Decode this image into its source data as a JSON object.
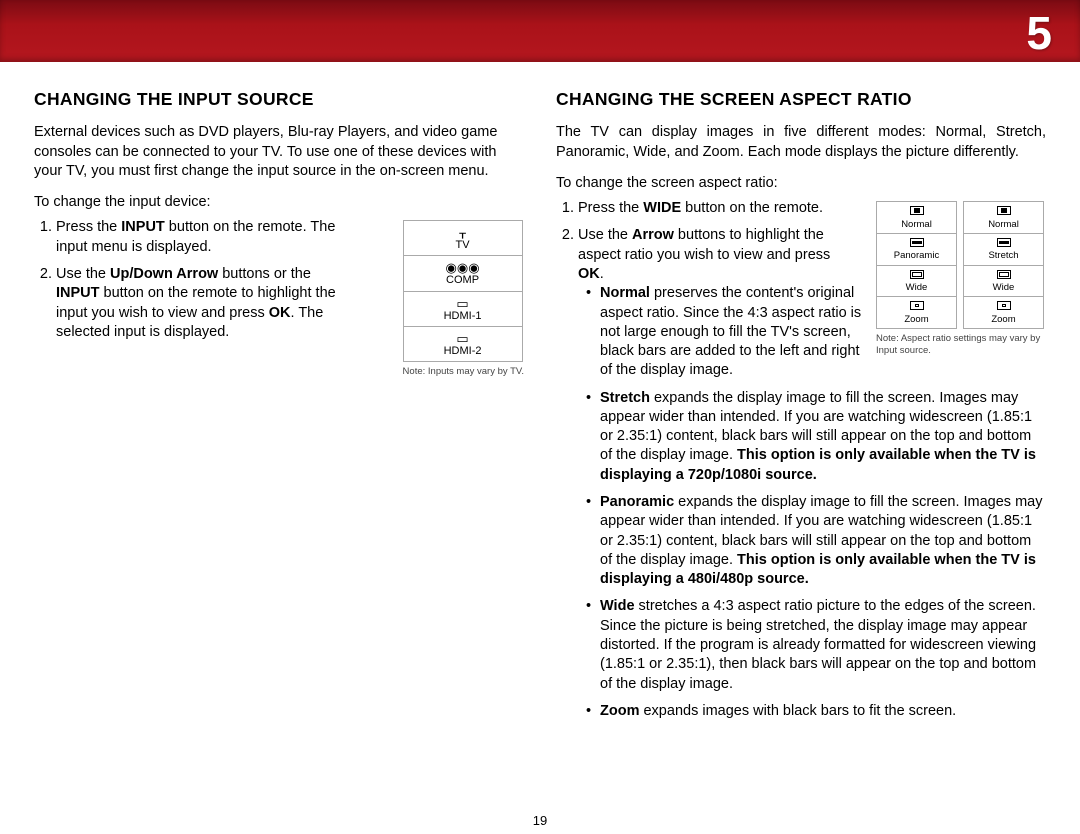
{
  "chapter_number": "5",
  "footer_page": "19",
  "left": {
    "heading": "CHANGING THE INPUT SOURCE",
    "intro": "External devices such as DVD players, Blu-ray Players, and video game consoles can be connected to your TV. To use one of these devices with your TV, you must first change the input source in the on-screen menu.",
    "lead": "To change the input device:",
    "steps": {
      "s1_a": "Press the ",
      "s1_b": "INPUT",
      "s1_c": " button on the remote. The input menu is displayed.",
      "s2_a": "Use the ",
      "s2_b": "Up/Down Arrow",
      "s2_c": " buttons or the ",
      "s2_d": "INPUT",
      "s2_e": " button on the remote to highlight the input you wish to view and press ",
      "s2_f": "OK",
      "s2_g": ". The selected input is displayed."
    },
    "menu": {
      "tv": "TV",
      "comp": "COMP",
      "hdmi1": "HDMI-1",
      "hdmi2": "HDMI-2"
    },
    "note": "Note: Inputs may vary by TV."
  },
  "right": {
    "heading": "CHANGING THE SCREEN ASPECT RATIO",
    "intro": "The TV can display images in five different modes: Normal, Stretch, Panoramic, Wide, and Zoom. Each mode displays the picture differently.",
    "lead": "To change the screen aspect ratio:",
    "steps": {
      "s1_a": "Press the ",
      "s1_b": "WIDE",
      "s1_c": " button on the remote.",
      "s2_a": "Use the ",
      "s2_b": "Arrow",
      "s2_c": " buttons to highlight the aspect ratio you wish to view and press ",
      "s2_d": "OK",
      "s2_e": "."
    },
    "bullets": {
      "normal_b": "Normal",
      "normal_t": " preserves the content's original aspect ratio. Since the 4:3 aspect ratio is not large enough to fill the TV's screen, black bars are added to the left and right of the display image.",
      "stretch_b": "Stretch",
      "stretch_t1": " expands the display image to fill the screen. Images may appear wider than intended. If you are watching widescreen (1.85:1 or 2.35:1) content, black bars will still appear on the top and bottom of the display image. ",
      "stretch_t2": "This option is only available when the TV is displaying a 720p/1080i source.",
      "pano_b": "Panoramic",
      "pano_t1": " expands the display image to fill the screen. Images may appear wider than intended. If you are watching widescreen (1.85:1 or 2.35:1) content, black bars will still appear on the top and bottom of the display image. ",
      "pano_t2": "This option is only available when the TV is displaying a 480i/480p source.",
      "wide_b": "Wide",
      "wide_t": " stretches a 4:3 aspect ratio picture to the edges of the screen. Since the picture is being stretched, the display image may appear distorted. If the program is already formatted for widescreen viewing (1.85:1 or 2.35:1), then black bars will appear on the top and bottom of the display image.",
      "zoom_b": "Zoom",
      "zoom_t": " expands images with black bars to fit the screen."
    },
    "aspect": {
      "col1": [
        "Normal",
        "Panoramic",
        "Wide",
        "Zoom"
      ],
      "col2": [
        "Normal",
        "Stretch",
        "Wide",
        "Zoom"
      ]
    },
    "note": "Note: Aspect ratio settings may vary by Input source."
  }
}
